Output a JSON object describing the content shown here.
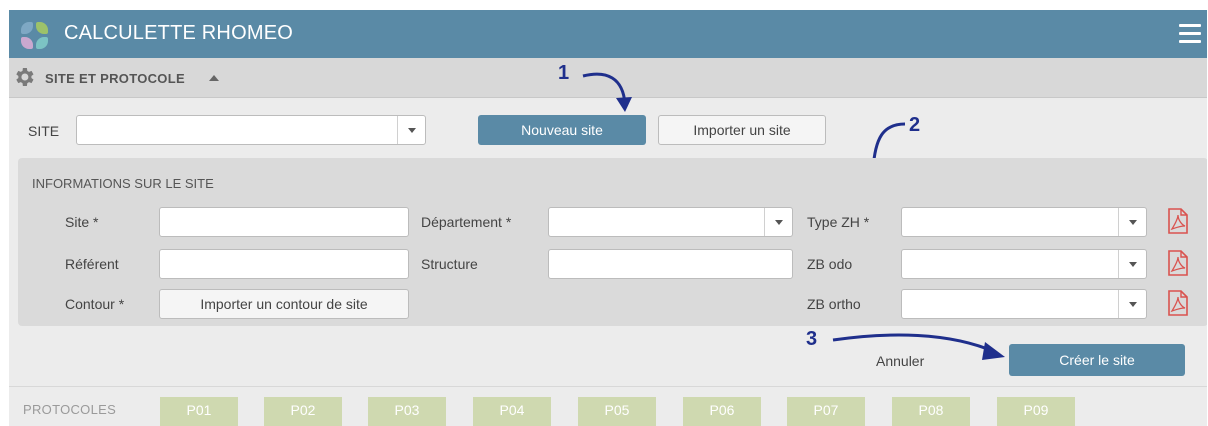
{
  "app": {
    "title": "CALCULETTE RHOMEO"
  },
  "section": {
    "label": "SITE ET PROTOCOLE"
  },
  "site_row": {
    "label": "SITE",
    "new_site_button": "Nouveau site",
    "import_site_button": "Importer un site"
  },
  "info_panel": {
    "heading": "INFORMATIONS SUR LE SITE",
    "site_label": "Site *",
    "referent_label": "Référent",
    "contour_label": "Contour *",
    "import_contour_button": "Importer un contour de site",
    "departement_label": "Département *",
    "structure_label": "Structure",
    "type_zh_label": "Type ZH *",
    "zb_odo_label": "ZB odo",
    "zb_ortho_label": "ZB ortho"
  },
  "actions": {
    "cancel": "Annuler",
    "create_site": "Créer le site"
  },
  "annotations": {
    "one": "1",
    "two": "2",
    "three": "3"
  },
  "protocols": {
    "label": "PROTOCOLES",
    "items": [
      "P01",
      "P02",
      "P03",
      "P04",
      "P05",
      "P06",
      "P07",
      "P08",
      "P09"
    ]
  },
  "colors": {
    "header": "#5a8aa6",
    "primary_button": "#5a8aa6",
    "annotation": "#1f2f8c",
    "pdf_icon": "#d9534f",
    "protocol_pill": "#cfd9b0"
  }
}
